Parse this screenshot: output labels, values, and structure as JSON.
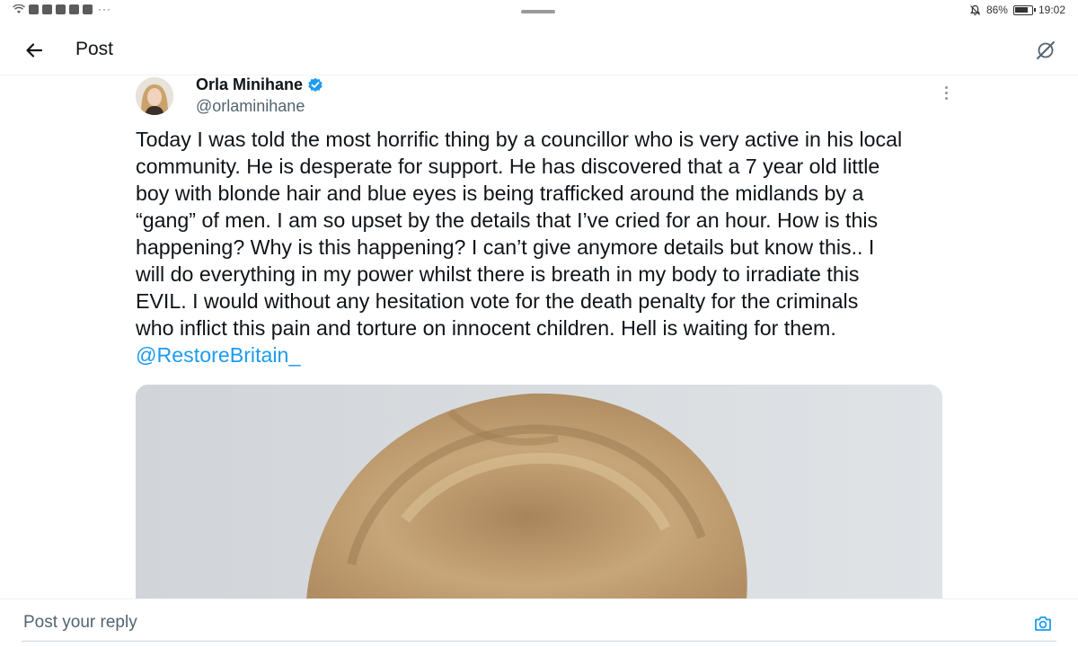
{
  "status_bar": {
    "battery_percent": "86%",
    "time": "19:02",
    "battery_level": 0.86
  },
  "header": {
    "title": "Post"
  },
  "post": {
    "author_name": "Orla Minihane",
    "handle": "@orlaminihane",
    "verified": true,
    "text": "Today I was told the most horrific thing by a councillor who is very active in his local\ncommunity. He is desperate for support. He has discovered that a 7 year old little\nboy with blonde hair and blue eyes is being trafficked around the midlands by a\n“gang” of men. I am so upset by the details that I’ve cried for an hour. How is this\nhappening? Why is this happening? I can’t give anymore details but know this.. I\nwill do everything in my power whilst there is breath in my body to irradiate this\nEVIL. I would without any hesitation vote for the death penalty for the criminals\nwho inflict this pain and torture on innocent children. Hell is waiting for them.",
    "mention": "@RestoreBritain_"
  },
  "reply": {
    "placeholder": "Post your reply"
  },
  "colors": {
    "accent": "#1d9bf0",
    "text": "#0f1419",
    "secondary": "#536471"
  },
  "icons": {
    "back": "arrow-left-icon",
    "grok": "grok-icon",
    "more": "more-vertical-icon",
    "verified": "verified-badge-icon",
    "camera": "camera-icon"
  }
}
